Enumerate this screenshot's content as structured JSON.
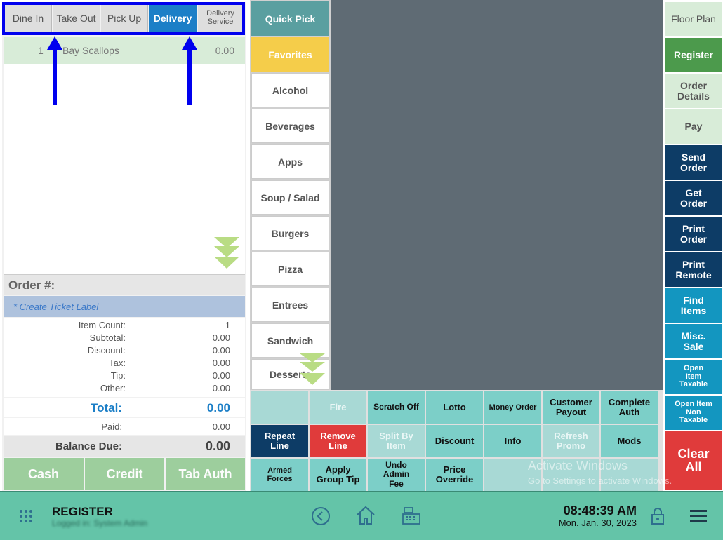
{
  "order_types": [
    {
      "label": "Dine In",
      "active": false
    },
    {
      "label": "Take Out",
      "active": false
    },
    {
      "label": "Pick Up",
      "active": false
    },
    {
      "label": "Delivery",
      "active": true
    },
    {
      "label": "Delivery Service",
      "active": false
    }
  ],
  "order_items": [
    {
      "qty": "1",
      "name": "Bay Scallops",
      "price": "0.00"
    }
  ],
  "order": {
    "number_label": "Order #:",
    "create_ticket_label": "* Create Ticket Label",
    "rows": [
      {
        "label": "Item Count:",
        "value": "1"
      },
      {
        "label": "Subtotal:",
        "value": "0.00"
      },
      {
        "label": "Discount:",
        "value": "0.00"
      },
      {
        "label": "Tax:",
        "value": "0.00"
      },
      {
        "label": "Tip:",
        "value": "0.00"
      },
      {
        "label": "Other:",
        "value": "0.00"
      }
    ],
    "total_label": "Total:",
    "total_value": "0.00",
    "paid_label": "Paid:",
    "paid_value": "0.00",
    "balance_label": "Balance Due:",
    "balance_value": "0.00"
  },
  "payment_buttons": [
    "Cash",
    "Credit",
    "Tab Auth"
  ],
  "categories": [
    "Quick Pick",
    "Favorites",
    "Alcohol",
    "Beverages",
    "Apps",
    "Soup / Salad",
    "Burgers",
    "Pizza",
    "Entrees",
    "Sandwich",
    "Desserts"
  ],
  "right_buttons": [
    {
      "label": "Floor Plan"
    },
    {
      "label": "Register"
    },
    {
      "label": "Order Details"
    },
    {
      "label": "Pay"
    },
    {
      "label": "Send Order"
    },
    {
      "label": "Get Order"
    },
    {
      "label": "Print Order"
    },
    {
      "label": "Print Remote"
    },
    {
      "label": "Find Items"
    },
    {
      "label": "Misc. Sale"
    },
    {
      "label": "Open Item Taxable"
    },
    {
      "label": "Open Item Non Taxable"
    },
    {
      "label": "Clear All"
    }
  ],
  "grid_buttons": [
    [
      "",
      "Fire",
      "Scratch Off",
      "Lotto",
      "Money Order",
      "Customer Payout",
      "Complete Auth"
    ],
    [
      "Repeat Line",
      "Remove Line",
      "Split By Item",
      "Discount",
      "Info",
      "Refresh Promo",
      "Mods"
    ],
    [
      "Armed Forces",
      "Apply Group Tip",
      "Undo Admin Fee",
      "Price Override",
      "",
      "",
      ""
    ]
  ],
  "watermark": {
    "title": "Activate Windows",
    "subtitle": "Go to Settings to activate Windows."
  },
  "bottom_bar": {
    "title": "REGISTER",
    "user": "Logged in: System Admin",
    "time": "08:48:39 AM",
    "date": "Mon. Jan. 30, 2023"
  },
  "colors": {
    "active_tab": "#1c7fc7",
    "annotation": "#0000ee",
    "favorites": "#f5cd4a",
    "quick_pick": "#5a9fa0",
    "register": "#4c9a4c",
    "navy": "#0d3c66",
    "cyan": "#1396c0",
    "red": "#e03b3b",
    "bottom_bar": "#64c4a8"
  }
}
